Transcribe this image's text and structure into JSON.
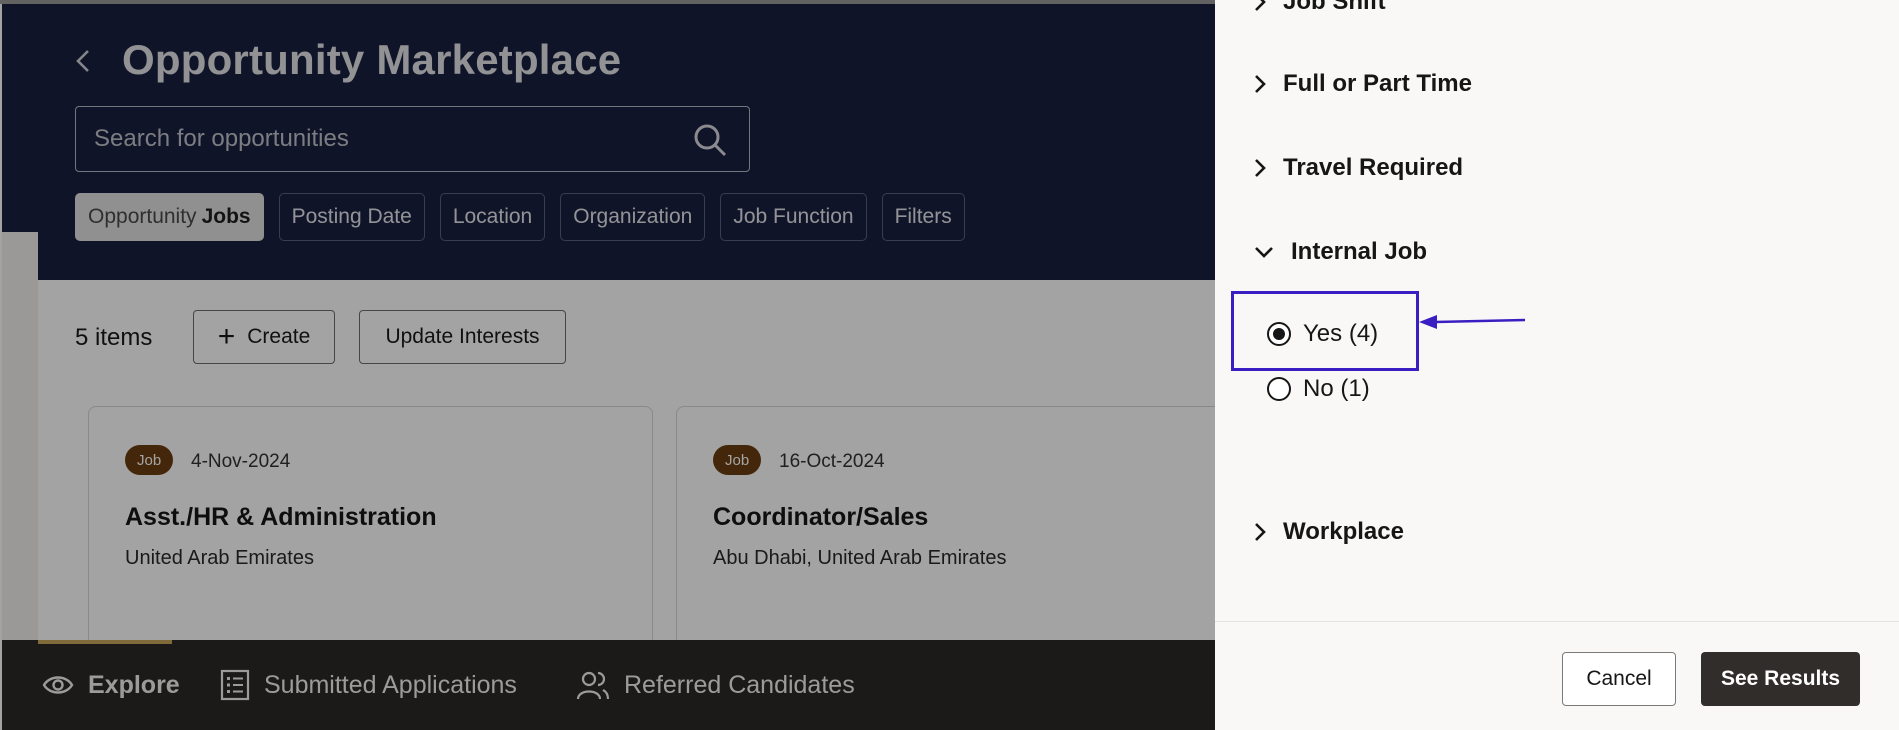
{
  "header": {
    "title": "Opportunity Marketplace",
    "search_placeholder": "Search for opportunities"
  },
  "chips": {
    "opportunity_prefix": "Opportunity",
    "opportunity_value": "Jobs",
    "posting_date": "Posting Date",
    "location": "Location",
    "organization": "Organization",
    "job_function": "Job Function",
    "filters": "Filters"
  },
  "toolbar": {
    "items_count": "5 items",
    "create_label": "Create",
    "update_label": "Update Interests"
  },
  "cards": [
    {
      "badge": "Job",
      "date": "4-Nov-2024",
      "title": "Asst./HR & Administration",
      "location": "United Arab Emirates"
    },
    {
      "badge": "Job",
      "date": "16-Oct-2024",
      "title": "Coordinator/Sales",
      "location": "Abu Dhabi, United Arab Emirates"
    }
  ],
  "bottom_nav": {
    "explore": "Explore",
    "submitted": "Submitted Applications",
    "referred": "Referred Candidates"
  },
  "filter_panel": {
    "sections": {
      "job_shift": "Job Shift",
      "full_or_part_time": "Full or Part Time",
      "travel_required": "Travel Required",
      "internal_job": "Internal Job",
      "workplace": "Workplace"
    },
    "internal_job_options": [
      {
        "label": "Yes (4)",
        "selected": true
      },
      {
        "label": "No (1)",
        "selected": false
      }
    ],
    "cancel_label": "Cancel",
    "see_results_label": "See Results"
  },
  "colors": {
    "header_bg": "#18203f",
    "badge_bg": "#6b3e10",
    "nav_bg": "#2d2a27",
    "annotation": "#3b1ec2",
    "primary_button": "#312d2a"
  }
}
